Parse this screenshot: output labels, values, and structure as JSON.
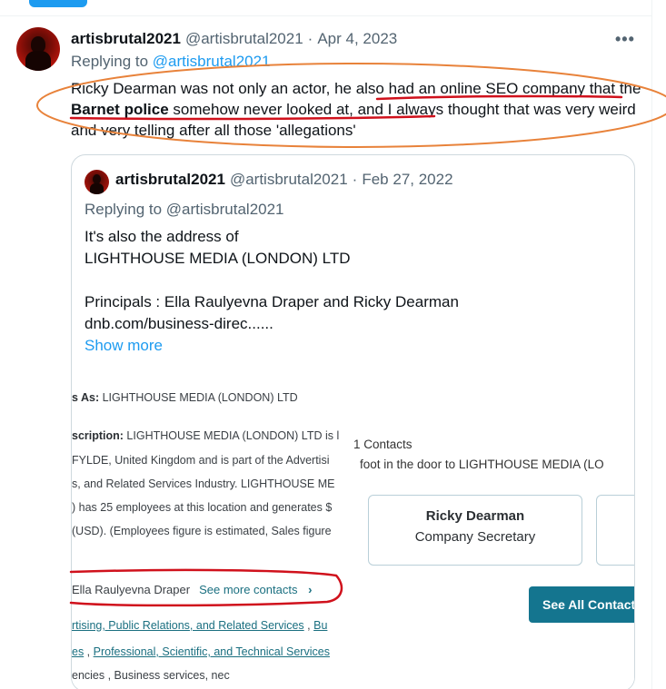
{
  "tweet": {
    "author_name": "artisbrutal2021",
    "author_handle": "@artisbrutal2021",
    "separator": "·",
    "date": "Apr 4, 2023",
    "more_icon": "more-dots-icon",
    "more_glyph": "•••",
    "replying_prefix": "Replying to",
    "replying_handle": "@artisbrutal2021",
    "text_1": "Ricky Dearman was not only an actor, he also had an online SEO company that the ",
    "text_bold": "Barnet police",
    "text_2": " somehow never looked at, and I always thought that was very weird and very telling after all those 'allegations'"
  },
  "quote": {
    "author_name": "artisbrutal2021",
    "author_handle": "@artisbrutal2021",
    "separator": "·",
    "date": "Feb 27, 2022",
    "replying_prefix": "Replying to",
    "replying_handle": "@artisbrutal2021",
    "body": "It's also the address of\nLIGHTHOUSE MEDIA (LONDON) LTD\n\nPrincipals  : Ella Raulyevna Draper and Ricky Dearman\ndnb.com/business-direc......",
    "show_more": "Show more"
  },
  "embedded_image": {
    "line_as_label": "s As:",
    "line_as_value": " LIGHTHOUSE MEDIA (LONDON) LTD",
    "desc_label": "scription:",
    "desc_value": " LIGHTHOUSE MEDIA (LONDON) LTD is l",
    "desc_2": "FYLDE, United Kingdom and is part of the Advertisi",
    "desc_3": "s, and Related Services Industry. LIGHTHOUSE ME",
    "desc_4": ") has 25 employees at this location and generates $",
    "desc_5": "(USD). (Employees figure is estimated, Sales figure",
    "contacts_title": "1 Contacts",
    "contacts_sub": "foot in the door to LIGHTHOUSE MEDIA (LO",
    "contact_name": "Ricky Dearman",
    "contact_title": "Company Secretary",
    "see_all": "See All Contact",
    "ella_name": "Ella Raulyevna Draper",
    "see_more_contacts": "See more contacts",
    "chevron": "›",
    "link_1": "rtising, Public Relations, and Related Services",
    "link_1_sep": " ,  ",
    "link_1b": "Bu",
    "link_2": "es",
    "link_2_sep": " ,  ",
    "link_2b": "Professional, Scientific, and Technical Services",
    "last_line": "encies ,  Business services, nec"
  },
  "colors": {
    "accent": "#1d9bf0",
    "annotation_orange": "#e8823a",
    "annotation_red": "#d0111c",
    "dnb_button": "#14758f"
  }
}
